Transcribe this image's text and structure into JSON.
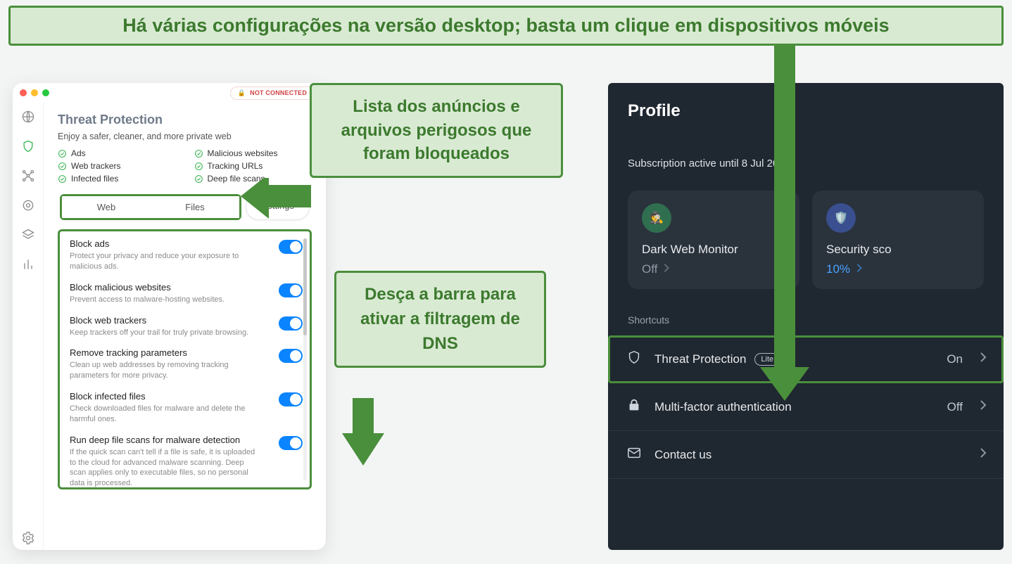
{
  "banner": {
    "text": "Há várias configurações na versão desktop; basta um clique em dispositivos móveis"
  },
  "callouts": {
    "c1": "Lista dos anúncios e arquivos perigosos que foram bloqueados",
    "c2": "Desça a barra para ativar a filtragem de DNS"
  },
  "desktop": {
    "status": "NOT CONNECTED",
    "title": "Threat Protection",
    "subtitle": "Enjoy a safer, cleaner, and more private web",
    "checks": [
      "Ads",
      "Malicious websites",
      "Web trackers",
      "Tracking URLs",
      "Infected files",
      "Deep file scans"
    ],
    "tabs": {
      "web": "Web",
      "files": "Files",
      "settings": "Settings"
    },
    "settings": [
      {
        "title": "Block ads",
        "desc": "Protect your privacy and reduce your exposure to malicious ads."
      },
      {
        "title": "Block malicious websites",
        "desc": "Prevent access to malware-hosting websites."
      },
      {
        "title": "Block web trackers",
        "desc": "Keep trackers off your trail for truly private browsing."
      },
      {
        "title": "Remove tracking parameters",
        "desc": "Clean up web addresses by removing tracking parameters for more privacy."
      },
      {
        "title": "Block infected files",
        "desc": "Check downloaded files for malware and delete the harmful ones."
      },
      {
        "title": "Run deep file scans for malware detection",
        "desc": "If the quick scan can't tell if a file is safe, it is uploaded to the cloud for advanced malware scanning. Deep scan applies only to executable files, so no personal data is processed."
      }
    ]
  },
  "mobile": {
    "title": "Profile",
    "subscription": "Subscription active until 8 Jul 2024",
    "cards": {
      "dwm": {
        "title": "Dark Web Monitor",
        "value": "Off"
      },
      "score": {
        "title": "Security score",
        "title_short": "Security sco",
        "value": "10%"
      }
    },
    "shortcuts_label": "Shortcuts",
    "items": {
      "tp": {
        "label": "Threat Protection",
        "badge": "Lite",
        "status": "On"
      },
      "mfa": {
        "label": "Multi-factor authentication",
        "status": "Off"
      },
      "contact": {
        "label": "Contact us"
      }
    }
  }
}
